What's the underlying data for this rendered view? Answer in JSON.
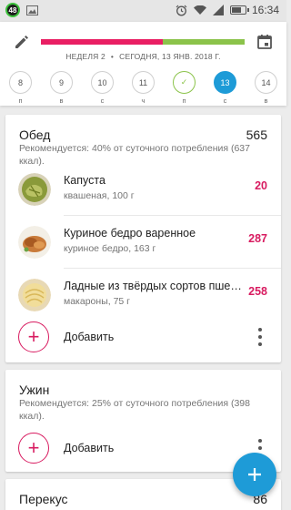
{
  "status_bar": {
    "notification_badge": "48",
    "time": "16:34",
    "icons": [
      "alarm-icon",
      "wifi-icon",
      "signal-icon",
      "battery-icon"
    ]
  },
  "header": {
    "week_label": "НЕДЕЛЯ 2",
    "separator": "•",
    "date_label": "СЕГОДНЯ, 13 ЯНВ. 2018 Г.",
    "progress_fraction": 0.6,
    "progress_colors": {
      "eaten": "#e91e63",
      "remaining": "#8bc34a"
    },
    "days": [
      {
        "num": "8",
        "letter": "п",
        "state": "normal"
      },
      {
        "num": "9",
        "letter": "в",
        "state": "normal"
      },
      {
        "num": "10",
        "letter": "с",
        "state": "normal"
      },
      {
        "num": "11",
        "letter": "ч",
        "state": "normal"
      },
      {
        "num": "✓",
        "letter": "п",
        "state": "check"
      },
      {
        "num": "13",
        "letter": "с",
        "state": "active"
      },
      {
        "num": "14",
        "letter": "в",
        "state": "normal"
      }
    ]
  },
  "lunch": {
    "title": "Обед",
    "total": "565",
    "recommendation": "Рекомендуется: 40% от суточного потребления (637 ккал).",
    "items": [
      {
        "name": "Капуста",
        "sub": "квашеная, 100 г",
        "kcal": "20",
        "image": "sauerkraut-image"
      },
      {
        "name": "Куриное бедро варенное",
        "sub": "куриное бедро, 163 г",
        "kcal": "287",
        "image": "chicken-thigh-image"
      },
      {
        "name": "Ладные из твёрдых сортов пшеницы",
        "sub": "макароны, 75 г",
        "kcal": "258",
        "image": "pasta-image"
      }
    ],
    "add_label": "Добавить"
  },
  "dinner": {
    "title": "Ужин",
    "recommendation": "Рекомендуется: 25% от суточного потребления (398 ккал).",
    "add_label": "Добавить"
  },
  "snack": {
    "title": "Перекус",
    "total": "86"
  },
  "colors": {
    "accent_pink": "#d81b60",
    "accent_blue": "#1e9bd7",
    "accent_green": "#8bc34a"
  }
}
